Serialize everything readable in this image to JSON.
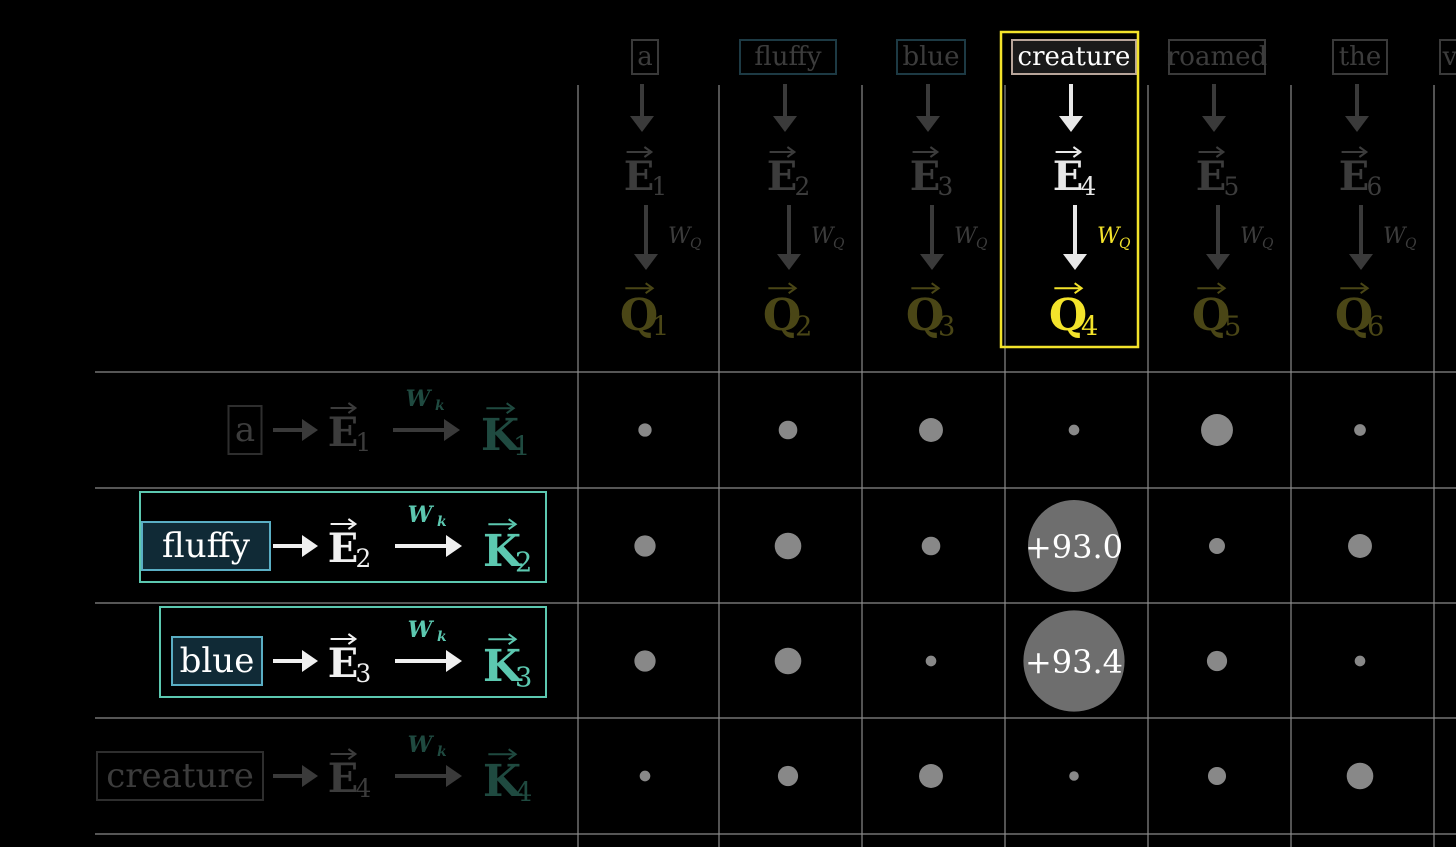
{
  "query_tokens": [
    {
      "word": "a",
      "e_sub": "1",
      "q_sub": "1",
      "highlight": false
    },
    {
      "word": "fluffy",
      "e_sub": "2",
      "q_sub": "2",
      "highlight": false
    },
    {
      "word": "blue",
      "e_sub": "3",
      "q_sub": "3",
      "highlight": false
    },
    {
      "word": "creature",
      "e_sub": "4",
      "q_sub": "4",
      "highlight": true
    },
    {
      "word": "roamed",
      "e_sub": "5",
      "q_sub": "5",
      "highlight": false
    },
    {
      "word": "the",
      "e_sub": "6",
      "q_sub": "6",
      "highlight": false
    },
    {
      "word": "v",
      "e_sub": "",
      "q_sub": "",
      "highlight": false
    }
  ],
  "key_tokens": [
    {
      "word": "a",
      "e_sub": "1",
      "k_sub": "1",
      "highlight": false
    },
    {
      "word": "fluffy",
      "e_sub": "2",
      "k_sub": "2",
      "highlight": true
    },
    {
      "word": "blue",
      "e_sub": "3",
      "k_sub": "3",
      "highlight": true
    },
    {
      "word": "creature",
      "e_sub": "4",
      "k_sub": "4",
      "highlight": false
    }
  ],
  "symbols": {
    "embedding": "E",
    "query": "Q",
    "key": "K",
    "wq": "W",
    "wq_sub": "Q",
    "wk": "W",
    "wk_sub": "k"
  },
  "grid_scores": [
    [
      0.25,
      0.35,
      0.45,
      0.2,
      0.6,
      0.22
    ],
    [
      0.4,
      0.5,
      0.35,
      2.0,
      0.3,
      0.45
    ],
    [
      0.4,
      0.5,
      0.2,
      2.2,
      0.38,
      0.2
    ],
    [
      0.2,
      0.38,
      0.45,
      0.18,
      0.34,
      0.5
    ]
  ],
  "highlight_values": [
    {
      "row": 1,
      "col": 3,
      "label": "+93.0"
    },
    {
      "row": 2,
      "col": 3,
      "label": "+93.4"
    }
  ],
  "colors": {
    "background": "#000000",
    "query_highlight": "#f3e32b",
    "key_highlight": "#5cc8b0",
    "grid_line": "#8a8a8a",
    "dot": "#888888",
    "big_dot": "#6e6e6e",
    "dim_text": "#3c3c3c",
    "dim_query": "#4a4616",
    "dim_key": "#1f4a40"
  }
}
